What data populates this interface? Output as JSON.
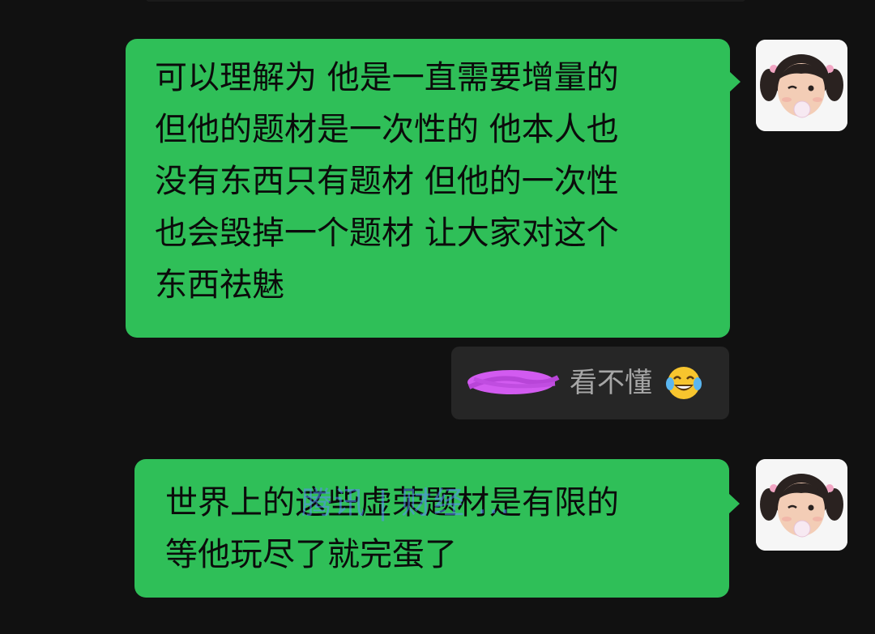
{
  "messages": [
    {
      "lines": [
        "可以理解为 他是一直需要增量的",
        "但他的题材是一次性的 他本人也",
        "没有东西只有题材 但他的一次性",
        "也会毁掉一个题材 让大家对这个",
        "东西祛魅"
      ],
      "bubble_color": "#2fbf58",
      "avatar_icon": "girl-avatar-icon"
    },
    {
      "lines": [
        "世界上的这些虚荣题材是有限的",
        "等他玩尽了就完蛋了"
      ],
      "bubble_color": "#2fbf58",
      "avatar_icon": "girl-avatar-icon"
    }
  ],
  "quote": {
    "text": "看不懂",
    "emoji_icon": "laughing-tears-emoji-icon",
    "redaction_color": "#d25bf0"
  },
  "watermark": {
    "text": "腾讯 | 财经 ..."
  },
  "colors": {
    "background": "#111111",
    "bubble": "#2fbf58",
    "quote_background": "#262626",
    "quote_text": "#a6a6a6"
  }
}
